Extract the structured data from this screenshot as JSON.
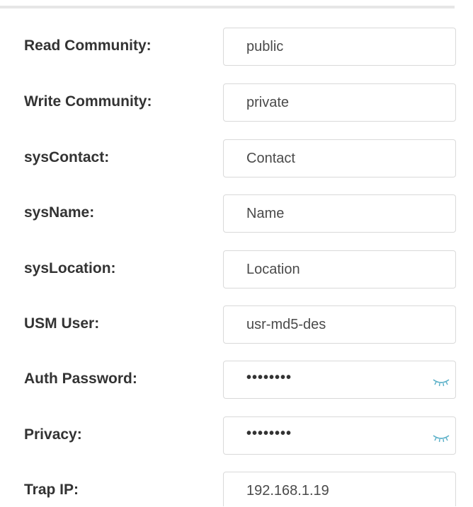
{
  "form": {
    "rows": [
      {
        "label": "Read Community:",
        "value": "public",
        "type": "text"
      },
      {
        "label": "Write Community:",
        "value": "private",
        "type": "text"
      },
      {
        "label": "sysContact:",
        "value": "Contact",
        "type": "text"
      },
      {
        "label": "sysName:",
        "value": "Name",
        "type": "text"
      },
      {
        "label": "sysLocation:",
        "value": "Location",
        "type": "text"
      },
      {
        "label": "USM User:",
        "value": "usr-md5-des",
        "type": "text"
      },
      {
        "label": "Auth Password:",
        "value": "••••••••",
        "type": "password",
        "icon": "eye-closed-icon"
      },
      {
        "label": "Privacy:",
        "value": "••••••••",
        "type": "password",
        "icon": "eye-closed-icon"
      },
      {
        "label": "Trap IP:",
        "value": "192.168.1.19",
        "type": "text"
      }
    ]
  },
  "colors": {
    "label": "#333333",
    "input_text": "#4a4a4a",
    "input_border": "#d9d9d9",
    "divider": "#e6e6e6",
    "eye_icon": "#5ab0c8"
  }
}
